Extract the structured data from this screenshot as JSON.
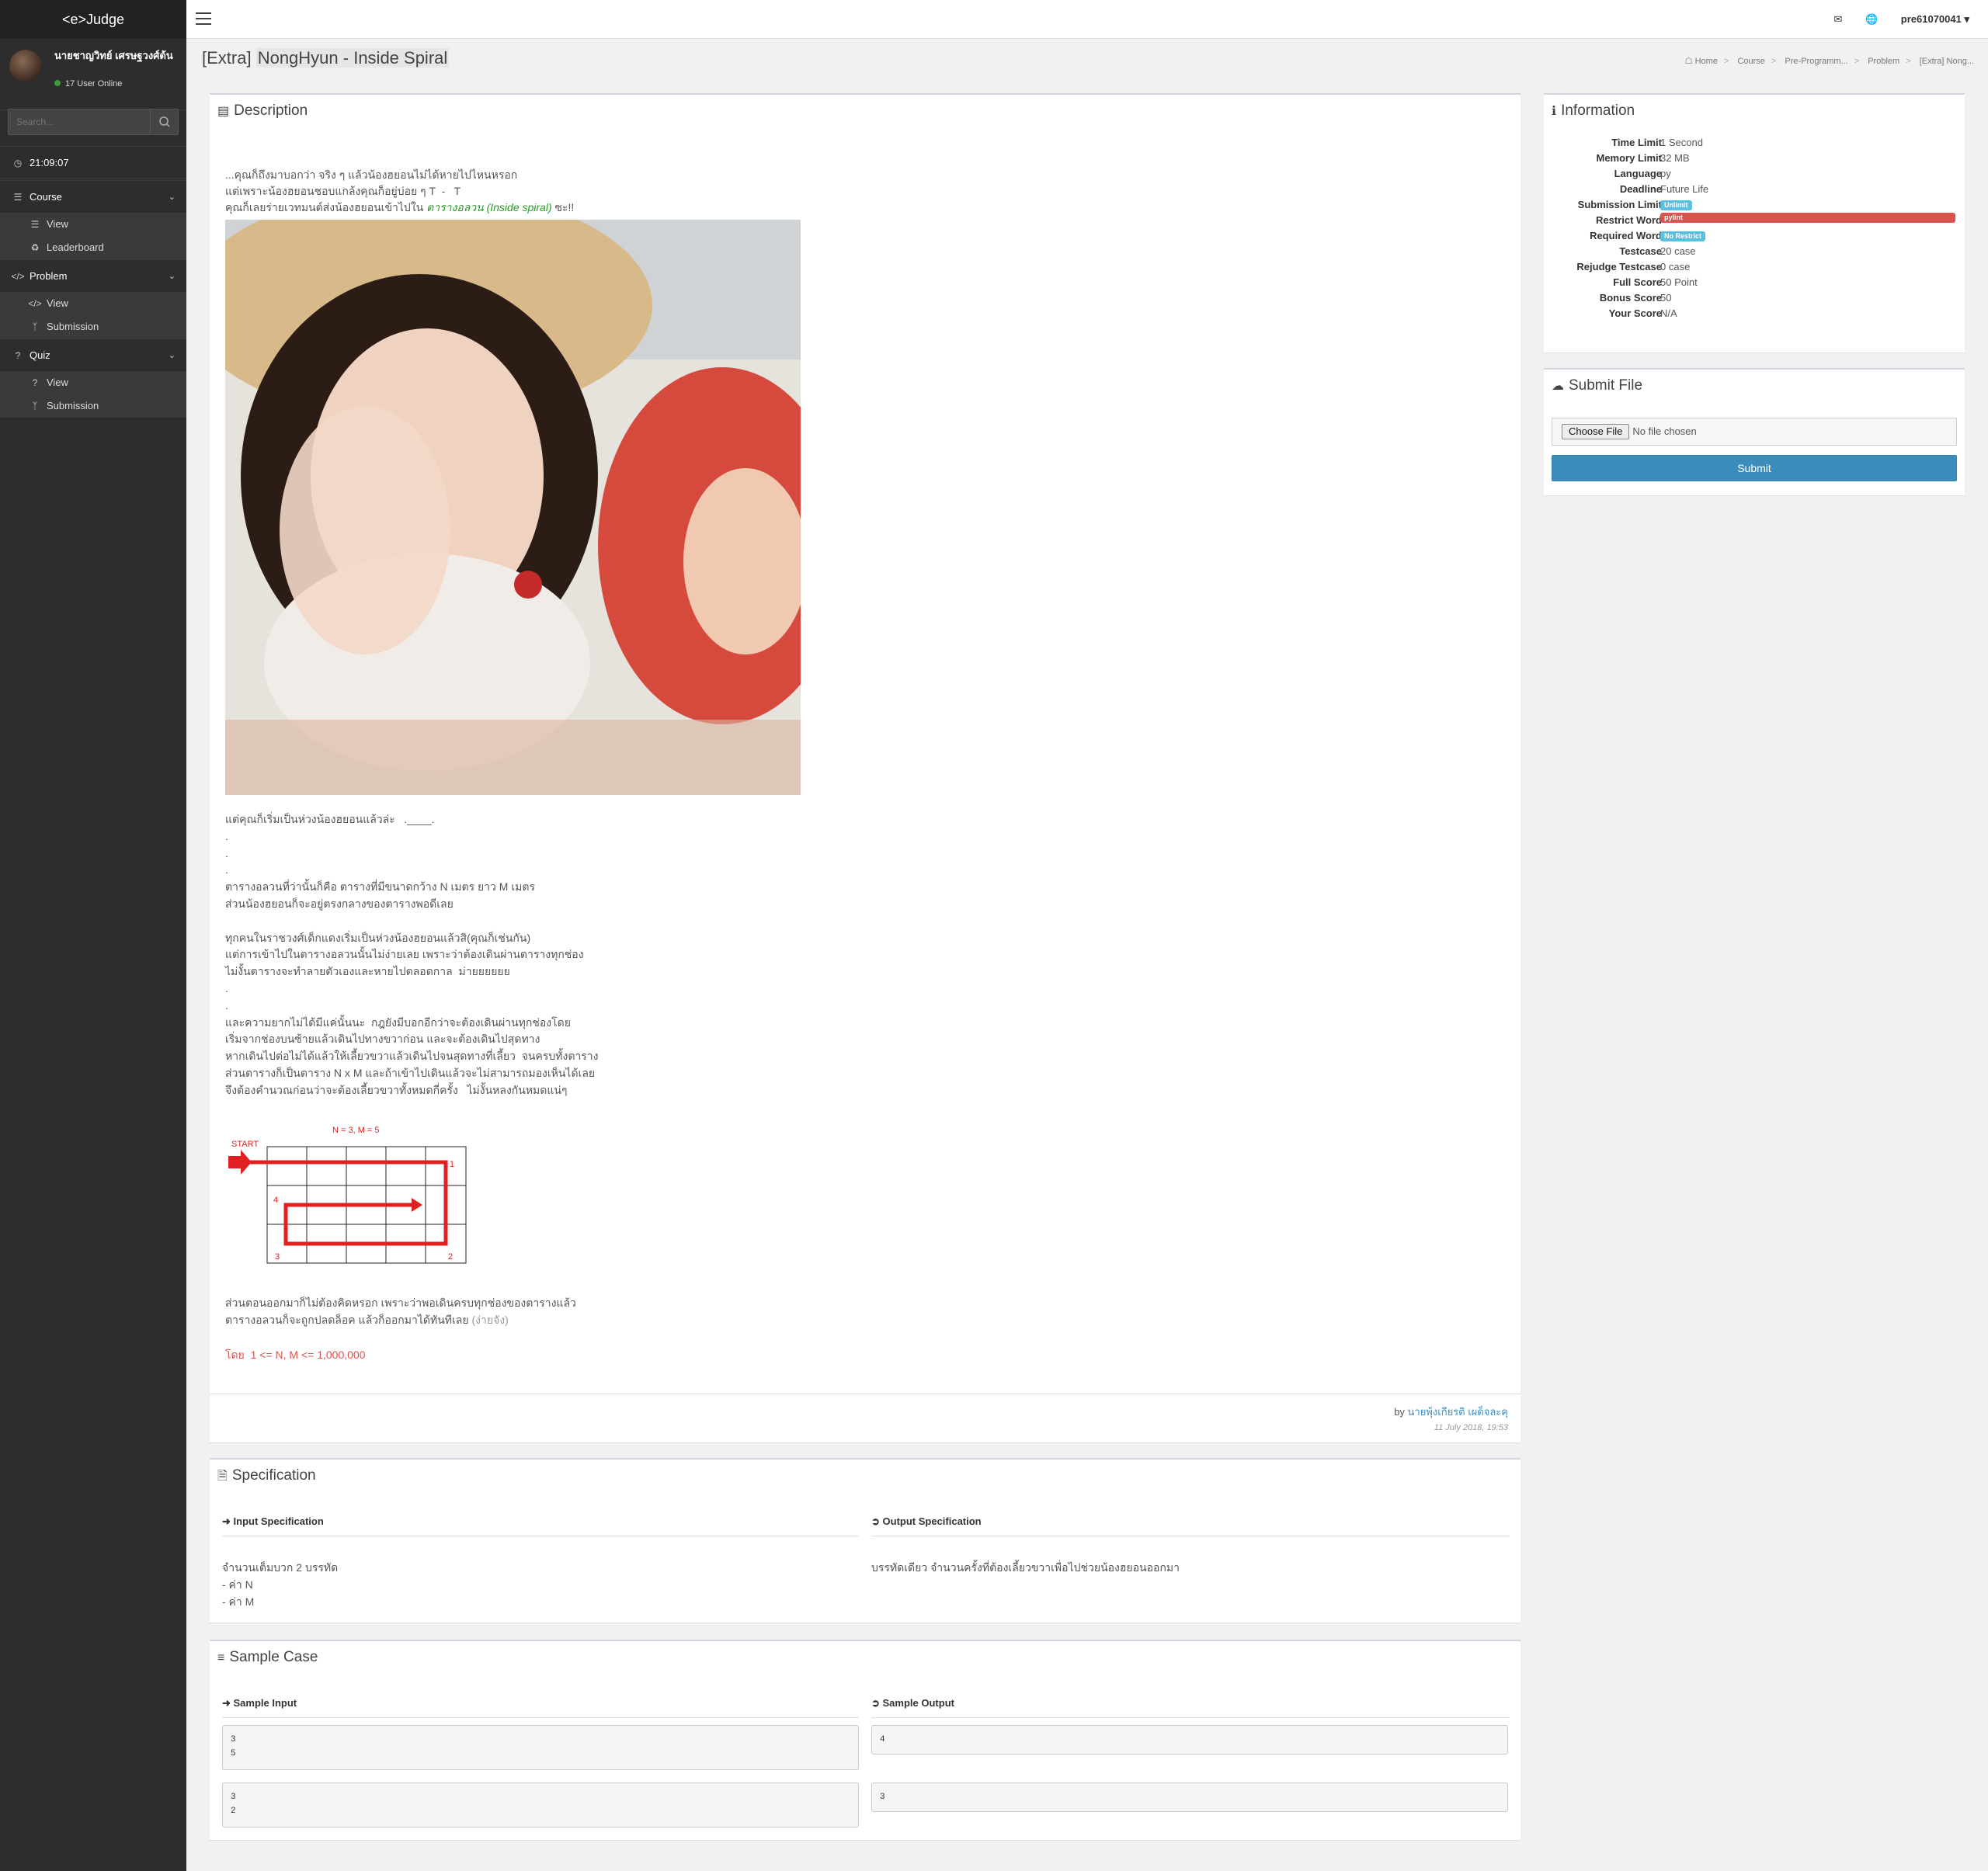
{
  "app": {
    "brand": "<e>Judge"
  },
  "sidebar": {
    "user_name": "นายชาญวิทย์ เศรษฐวงศ์ต้น",
    "online": "17 User Online",
    "search_placeholder": "Search...",
    "clock": "21:09:07",
    "course": {
      "label": "Course",
      "items": [
        "View",
        "Leaderboard"
      ]
    },
    "problem": {
      "label": "Problem",
      "items": [
        "View",
        "Submission"
      ]
    },
    "quiz": {
      "label": "Quiz",
      "items": [
        "View",
        "Submission"
      ]
    }
  },
  "topbar": {
    "username": "pre61070041"
  },
  "header": {
    "title_prefix": "[Extra]",
    "title_main": "NongHyun - Inside Spiral",
    "breadcrumb": [
      "Home",
      "Course",
      "Pre-Programm...",
      "Problem",
      "[Extra] Nong..."
    ]
  },
  "description": {
    "title": "Description",
    "intro_line1": "...คุณก็ถึงมาบอกว่า จริง ๆ แล้วน้องฮยอนไม่ได้หายไปไหนหรอก",
    "intro_line2": "แต่เพราะน้องฮยอนชอบแกล้งคุณก็อยู่บ่อย ๆ T  -   T",
    "intro_line3_a": "คุณก็เลยร่ายเวทมนต์ส่งน้องฮยอนเข้าไปใน ",
    "intro_line3_green": "ตารางอลวน (Inside spiral)",
    "intro_line3_b": " ซะ!!",
    "para1": "แต่คุณก็เริ่มเป็นห่วงน้องฮยอนแล้วล่ะ   .____.\n.\n.\n.\nตารางอลวนที่ว่านั้นก็คือ ตารางที่มีขนาดกว้าง N เมตร ยาว M เมตร\nส่วนน้องฮยอนก็จะอยู่ตรงกลางของตารางพอดีเลย\n\nทุกคนในราชวงศ์เด็กแดงเริ่มเป็นห่วงน้องฮยอนแล้วสิ(คุณก็เช่นกัน)\nแต่การเข้าไปในตารางอลวนนั้นไม่ง่ายเลย เพราะว่าต้องเดินผ่านตารางทุกช่อง\nไม่งั้นตารางจะทำลายตัวเองและหายไปตลอดกาล  ม่ายยยยยย\n.\n.\nและความยากไม่ได้มีแค่นั้นนะ  กฎยังมีบอกอีกว่าจะต้องเดินผ่านทุกช่องโดย\nเริ่มจากช่องบนซ้ายแล้วเดินไปทางขวาก่อน และจะต้องเดินไปสุดทาง\nหากเดินไปต่อไม่ได้แล้วให้เลี้ยวขวาแล้วเดินไปจนสุดทางที่เลี้ยว  จนครบทั้งตาราง\nส่วนตารางก็เป็นตาราง N x M และถ้าเข้าไปเดินแล้วจะไม่สามารถมองเห็นได้เลย\nจึงต้องคำนวณก่อนว่าจะต้องเลี้ยวขวาทั้งหมดกี่ครั้ง   ไม่งั้นหลงกันหมดแน่ๆ",
    "diagram": {
      "label_nm": "N = 3, M = 5",
      "start": "START",
      "n1": "1",
      "n2": "2",
      "n3": "3",
      "n4": "4"
    },
    "para2": "ส่วนตอนออกมาก็ไม่ต้องคิดหรอก เพราะว่าพอเดินครบทุกช่องของตารางแล้ว\nตารางอลวนก็จะถูกปลดล็อค แล้วก็ออกมาได้ทันทีเลย ",
    "para2_grey": "(ง่ายจัง)",
    "constraint": "โดย  1 <= N, M <= 1,000,000",
    "by": "by ",
    "author": "นายพุ้งเกียรติ เผด็จละคุ",
    "date": "11 July 2018, 19:53"
  },
  "information": {
    "title": "Information",
    "rows": [
      {
        "k": "Time Limit",
        "v": "1 Second"
      },
      {
        "k": "Memory Limit",
        "v": "32 MB"
      },
      {
        "k": "Language",
        "v": "py"
      },
      {
        "k": "Deadline",
        "v": "Future Life"
      },
      {
        "k": "Submission Limit",
        "badge": "Unlimit"
      },
      {
        "k": "Restrict Word",
        "badge": "pylint"
      },
      {
        "k": "Required Word",
        "badge": "No Restrict"
      },
      {
        "k": "Testcase",
        "v": "20 case"
      },
      {
        "k": "Rejudge Testcase",
        "v": "0 case"
      },
      {
        "k": "Full Score",
        "v": "50 Point"
      },
      {
        "k": "Bonus Score",
        "v": "50"
      },
      {
        "k": "Your Score",
        "v": "N/A"
      }
    ]
  },
  "submit": {
    "title": "Submit File",
    "choose": "Choose File",
    "no_file": "No file chosen",
    "button": "Submit"
  },
  "specification": {
    "title": "Specification",
    "input_head": "Input Specification",
    "output_head": "Output Specification",
    "input_text": "จำนวนเต็มบวก 2 บรรทัด\n- ค่า N\n- ค่า M",
    "output_text": "บรรทัดเดียว จำนวนครั้งที่ต้องเลี้ยวขวาเพื่อไปช่วยน้องฮยอนออกมา"
  },
  "sample": {
    "title": "Sample Case",
    "input_head": "Sample Input",
    "output_head": "Sample Output",
    "cases": [
      {
        "in": "3\n5",
        "out": "4"
      },
      {
        "in": "3\n2",
        "out": "3"
      }
    ]
  },
  "colors": {
    "accent": "#3c8dbc",
    "sidebar": "#2d2d2d",
    "badge_blue": "#5bc0de",
    "badge_red": "#d9534f",
    "diagram_red": "#e02020"
  }
}
